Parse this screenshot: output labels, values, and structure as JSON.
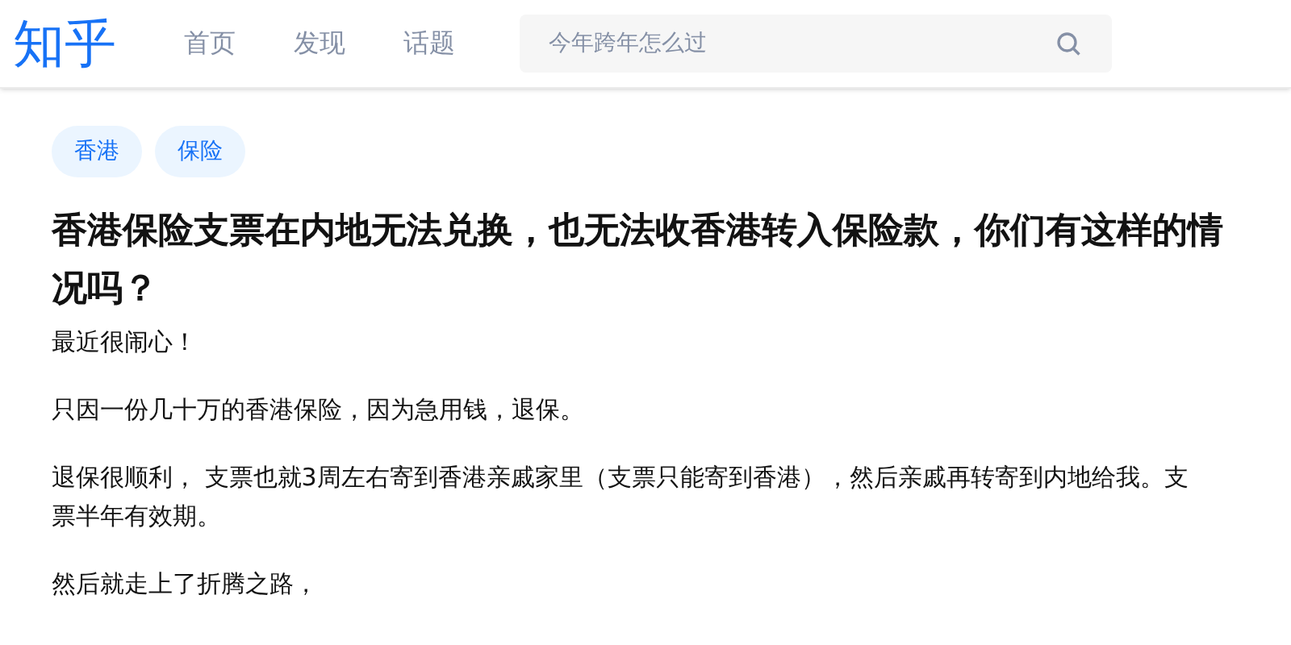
{
  "header": {
    "logo": "知乎",
    "nav": [
      {
        "label": "首页",
        "selected": false
      },
      {
        "label": "发现",
        "selected": false
      },
      {
        "label": "话题",
        "selected": false
      }
    ],
    "search": {
      "placeholder": "今年跨年怎么过"
    }
  },
  "question": {
    "tags": [
      "香港",
      "保险"
    ],
    "title": "香港保险支票在内地无法兑换，也无法收香港转入保险款，你们有这样的情况吗？",
    "paragraphs": [
      "最近很闹心！",
      "只因一份几十万的香港保险，因为急用钱，退保。",
      "退保很顺利， 支票也就3周左右寄到香港亲戚家里（支票只能寄到香港），然后亲戚再转寄到内地给我。支票半年有效期。",
      "然后就走上了折腾之路，"
    ]
  }
}
